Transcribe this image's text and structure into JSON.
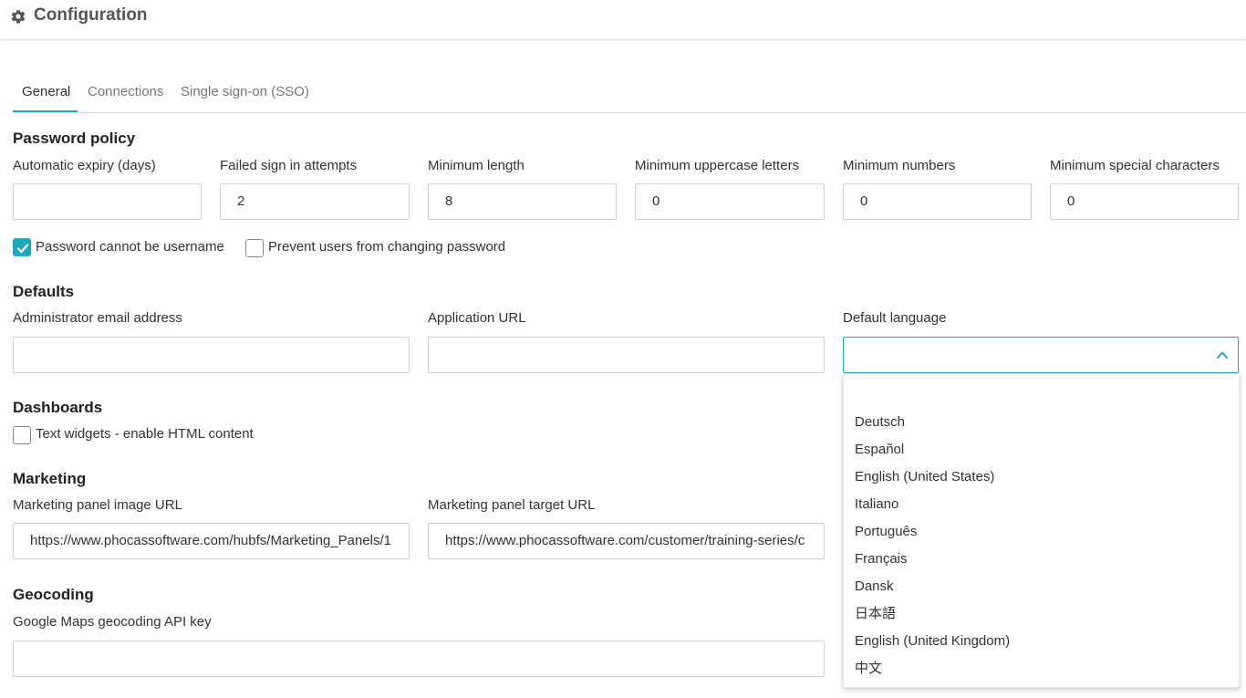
{
  "header": {
    "title": "Configuration",
    "icon": "gear-icon"
  },
  "tabs": [
    {
      "label": "General",
      "active": true
    },
    {
      "label": "Connections",
      "active": false
    },
    {
      "label": "Single sign-on (SSO)",
      "active": false
    }
  ],
  "password_policy": {
    "title": "Password policy",
    "fields": [
      {
        "label": "Automatic expiry (days)",
        "value": ""
      },
      {
        "label": "Failed sign in attempts",
        "value": "2"
      },
      {
        "label": "Minimum length",
        "value": "8"
      },
      {
        "label": "Minimum uppercase letters",
        "value": "0"
      },
      {
        "label": "Minimum numbers",
        "value": "0"
      },
      {
        "label": "Minimum special characters",
        "value": "0"
      }
    ],
    "checkboxes": [
      {
        "label": "Password cannot be username",
        "checked": true
      },
      {
        "label": "Prevent users from changing password",
        "checked": false
      }
    ]
  },
  "defaults": {
    "title": "Defaults",
    "admin_email": {
      "label": "Administrator email address",
      "value": ""
    },
    "app_url": {
      "label": "Application URL",
      "value": ""
    },
    "language": {
      "label": "Default language",
      "value": "",
      "options": [
        "Deutsch",
        "Español",
        "English (United States)",
        "Italiano",
        "Português",
        "Français",
        "Dansk",
        "日本語",
        "English (United Kingdom)",
        "中文"
      ]
    }
  },
  "dashboards": {
    "title": "Dashboards",
    "checkbox": {
      "label": "Text widgets - enable HTML content",
      "checked": false
    }
  },
  "marketing": {
    "title": "Marketing",
    "image_url": {
      "label": "Marketing panel image URL",
      "value": "https://www.phocassoftware.com/hubfs/Marketing_Panels/1"
    },
    "target_url": {
      "label": "Marketing panel target URL",
      "value": "https://www.phocassoftware.com/customer/training-series/c"
    }
  },
  "geocoding": {
    "title": "Geocoding",
    "api_key": {
      "label": "Google Maps geocoding API key",
      "value": ""
    }
  },
  "colors": {
    "accent": "#1fa9bd",
    "border": "#cfcfcf",
    "text": "#333333"
  }
}
